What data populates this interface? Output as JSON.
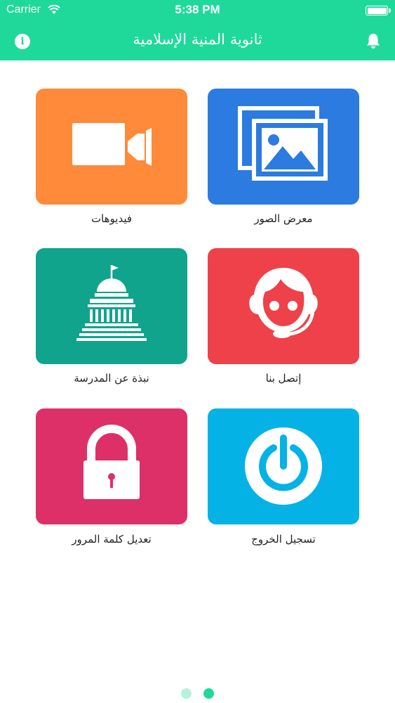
{
  "status_bar": {
    "carrier": "Carrier",
    "time": "5:38 PM",
    "battery_level": 1.0
  },
  "header": {
    "title": "ثانوية المنية الإسلامية",
    "info_icon": "info-icon",
    "bell_icon": "bell-icon",
    "info_glyph": "i"
  },
  "colors": {
    "header": "#1fd99a",
    "videos": "#fe8a3a",
    "gallery": "#2b7be0",
    "about": "#10a48c",
    "contact": "#ee4149",
    "password": "#de3068",
    "logout": "#05b2e6"
  },
  "menu": {
    "gallery_label": "معرض الصور",
    "videos_label": "فيديوهات",
    "contact_label": "إتصل بنا",
    "about_label": "نبذة عن المدرسة",
    "logout_label": "تسجيل الخروج",
    "password_label": "تعديل كلمة المرور"
  },
  "pager": {
    "page_count": 2,
    "current_page": 2
  }
}
